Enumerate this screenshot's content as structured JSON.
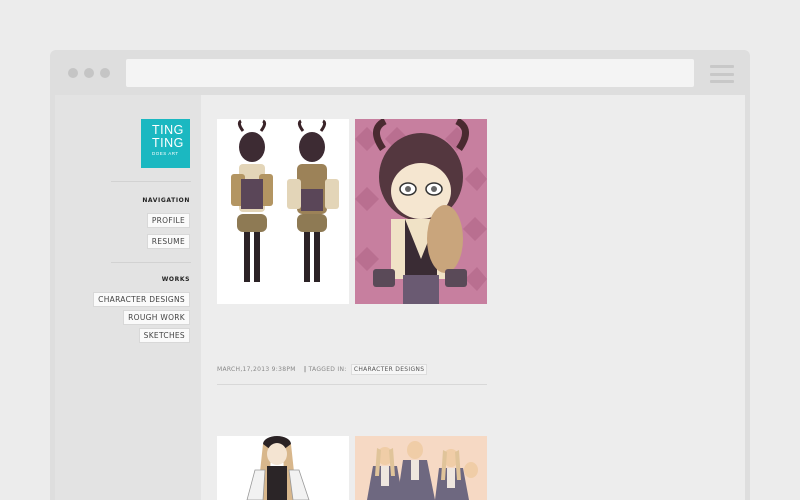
{
  "logo": {
    "line1": "TING",
    "line2": "TING",
    "tagline": "DOES ART"
  },
  "navigation": {
    "heading": "NAVIGATION",
    "items": [
      "PROFILE",
      "RESUME"
    ]
  },
  "works": {
    "heading": "WORKS",
    "items": [
      "CHARACTER DESIGNS",
      "ROUGH WORK",
      "SKETCHES"
    ]
  },
  "post": {
    "date": "MARCH,17,2013 9:38PM",
    "tagged_label": "TAGGED IN:",
    "tag": "CHARACTER DESIGNS"
  },
  "colors": {
    "accent": "#1bb8c1",
    "pink_bg": "#c77f9f",
    "peach_bg": "#f6d9c4"
  }
}
